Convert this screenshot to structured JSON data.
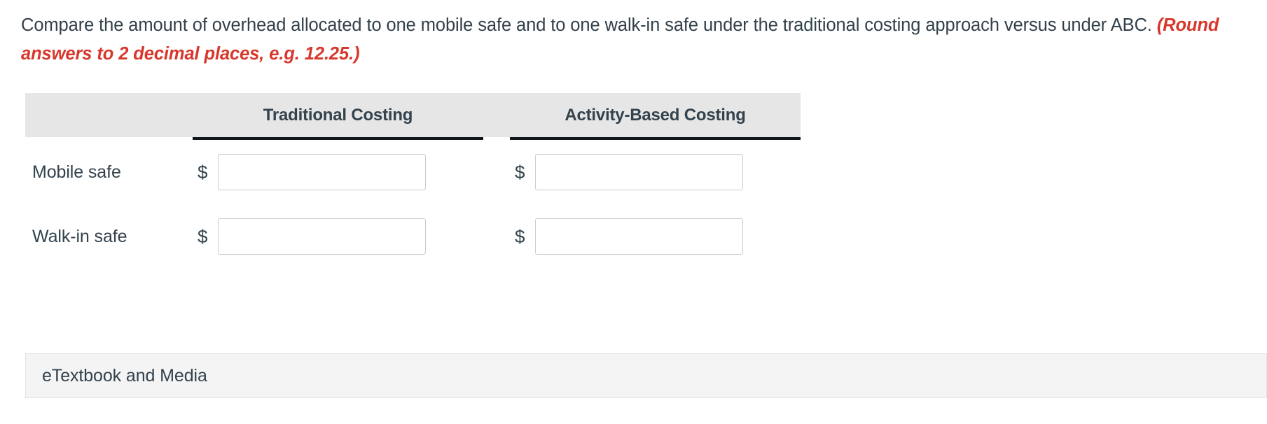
{
  "prompt": {
    "main": "Compare the amount of overhead allocated to one mobile safe and to one walk-in safe under the traditional costing approach versus under ABC. ",
    "hint": "(Round answers to 2 decimal places, e.g. 12.25.)",
    "hint_color": "#d8372c"
  },
  "table": {
    "header_bg": "#e6e6e6",
    "rule_color": "#10161a",
    "columns": [
      {
        "label": ""
      },
      {
        "label": "Traditional Costing"
      },
      {
        "label": "Activity-Based Costing"
      }
    ],
    "currency_symbol": "$",
    "rows": [
      {
        "label": "Mobile safe",
        "traditional": {
          "value": "",
          "placeholder": ""
        },
        "abc": {
          "value": "",
          "placeholder": ""
        }
      },
      {
        "label": "Walk-in safe",
        "traditional": {
          "value": "",
          "placeholder": ""
        },
        "abc": {
          "value": "",
          "placeholder": ""
        }
      }
    ]
  },
  "footer": {
    "etextbook_label": "eTextbook and Media"
  }
}
